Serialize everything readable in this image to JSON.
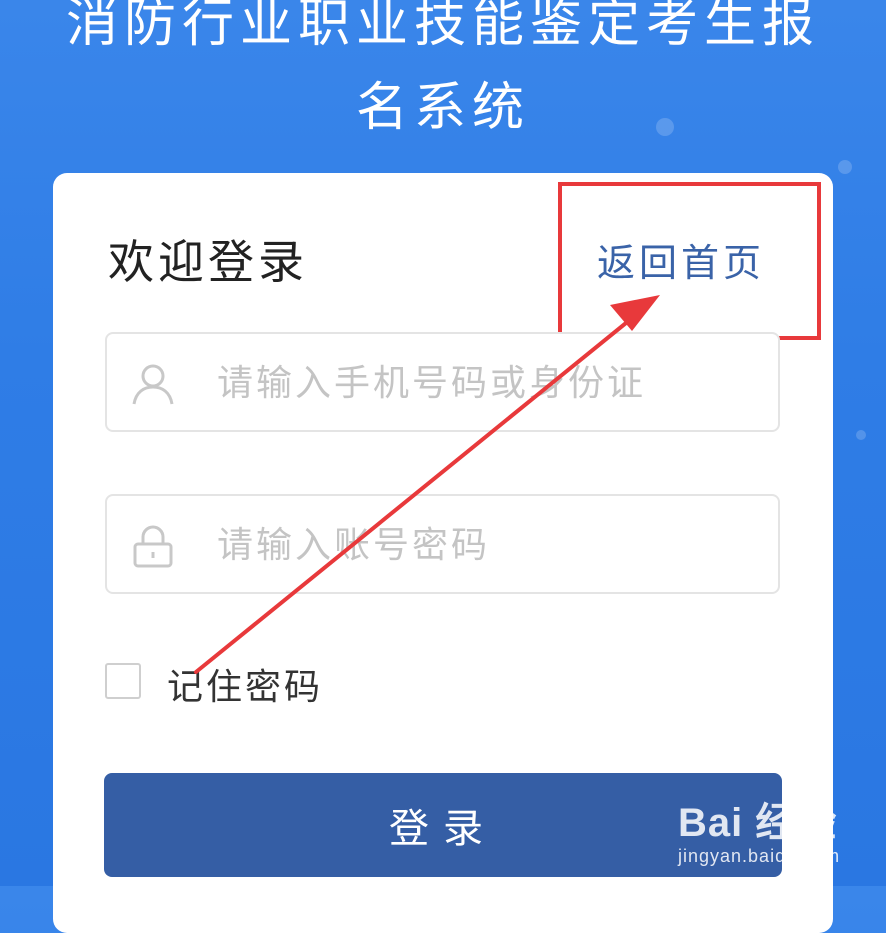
{
  "header": {
    "title": "消防行业职业技能鉴定考生报名系统"
  },
  "card": {
    "welcome": "欢迎登录",
    "home_link": "返回首页"
  },
  "form": {
    "account_placeholder": "请输入手机号码或身份证",
    "password_placeholder": "请输入账号密码",
    "remember_label": "记住密码",
    "login_label": "登录"
  },
  "annotation": {
    "highlight_color": "#e8393b"
  },
  "watermark": {
    "brand": "Bai 经验",
    "url": "jingyan.baidu.com"
  },
  "colors": {
    "primary": "#355ea5",
    "link": "#3a63a8",
    "background": "#2f7de6"
  }
}
